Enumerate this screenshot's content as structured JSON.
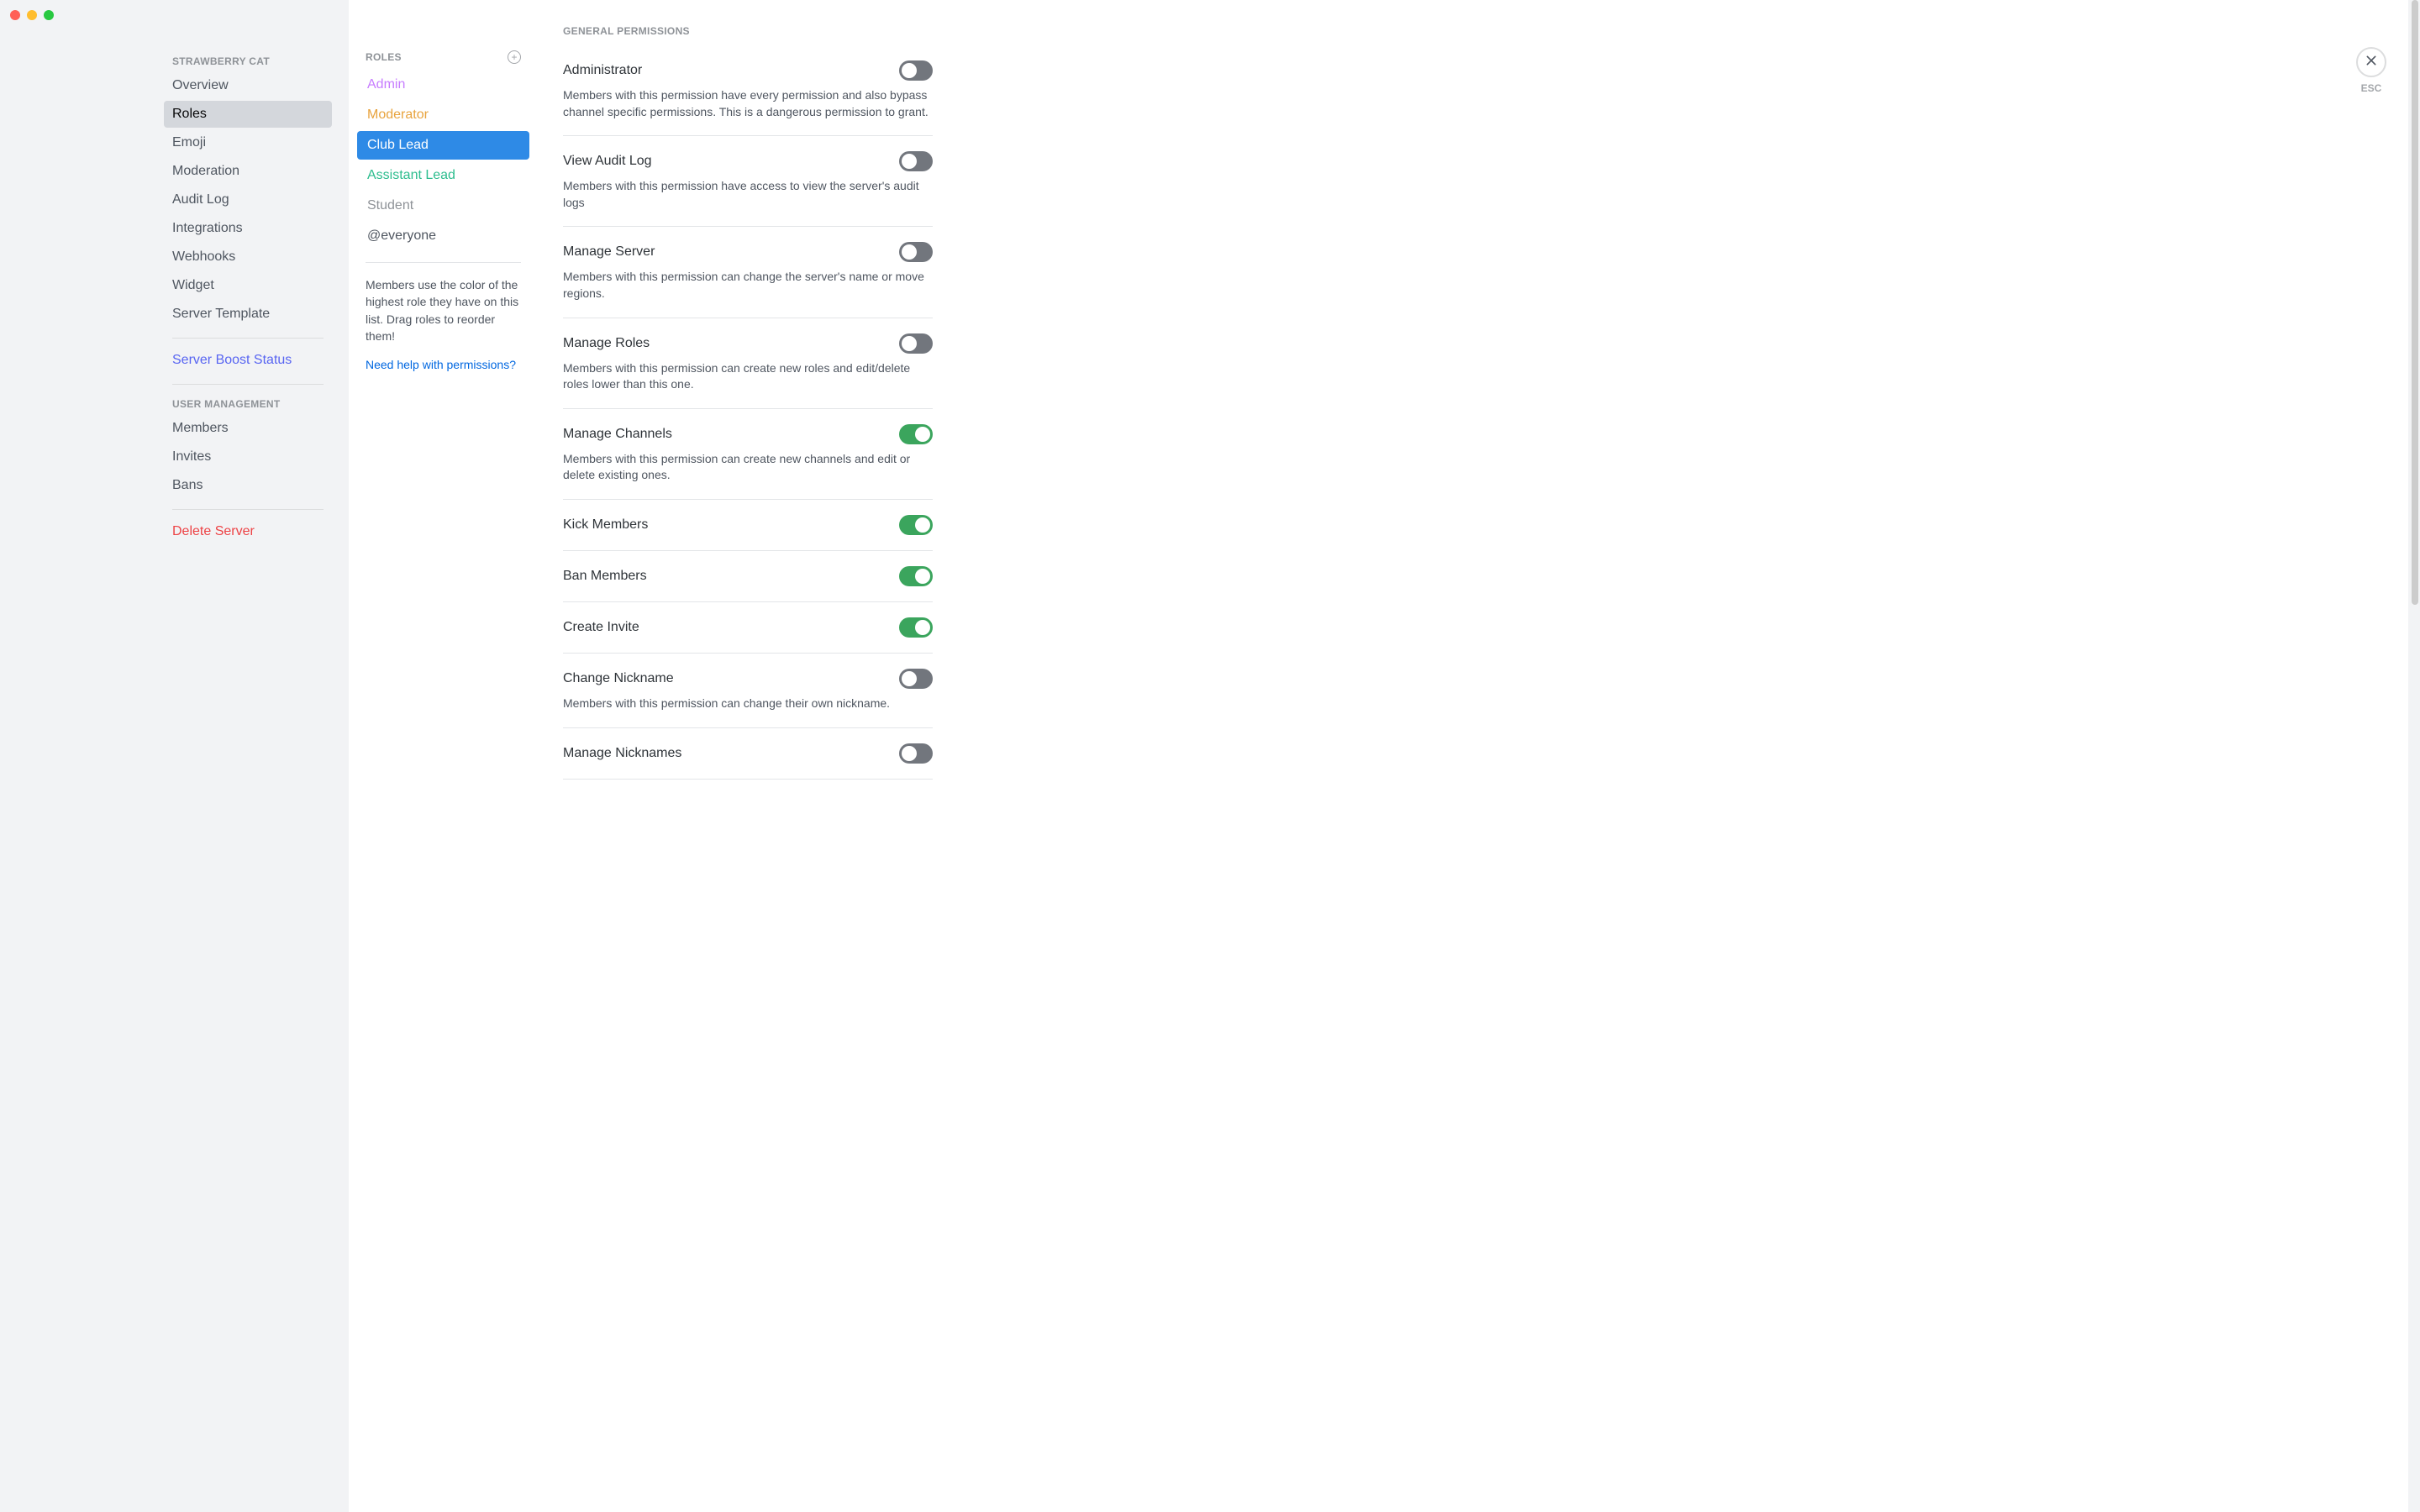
{
  "window": {
    "esc_label": "ESC"
  },
  "sidebar": {
    "server_name": "STRAWBERRY CAT",
    "items": [
      {
        "label": "Overview"
      },
      {
        "label": "Roles"
      },
      {
        "label": "Emoji"
      },
      {
        "label": "Moderation"
      },
      {
        "label": "Audit Log"
      },
      {
        "label": "Integrations"
      },
      {
        "label": "Webhooks"
      },
      {
        "label": "Widget"
      },
      {
        "label": "Server Template"
      }
    ],
    "boost_label": "Server Boost Status",
    "user_mgmt_header": "USER MANAGEMENT",
    "user_items": [
      {
        "label": "Members"
      },
      {
        "label": "Invites"
      },
      {
        "label": "Bans"
      }
    ],
    "delete_label": "Delete Server"
  },
  "roles": {
    "header": "ROLES",
    "list": [
      {
        "label": "Admin",
        "color": "#c77dff",
        "selected": false
      },
      {
        "label": "Moderator",
        "color": "#e8a33d",
        "selected": false
      },
      {
        "label": "Club Lead",
        "color": "#ffffff",
        "selected": true
      },
      {
        "label": "Assistant Lead",
        "color": "#2dbd8e",
        "selected": false
      },
      {
        "label": "Student",
        "color": "#8e9297",
        "selected": false
      },
      {
        "label": "@everyone",
        "color": "#4f5660",
        "selected": false
      }
    ],
    "hint": "Members use the color of the highest role they have on this list. Drag roles to reorder them!",
    "help_link": "Need help with permissions?"
  },
  "permissions": {
    "section_header": "GENERAL PERMISSIONS",
    "items": [
      {
        "title": "Administrator",
        "desc": "Members with this permission have every permission and also bypass channel specific permissions. This is a dangerous permission to grant.",
        "on": false
      },
      {
        "title": "View Audit Log",
        "desc": "Members with this permission have access to view the server's audit logs",
        "on": false
      },
      {
        "title": "Manage Server",
        "desc": "Members with this permission can change the server's name or move regions.",
        "on": false
      },
      {
        "title": "Manage Roles",
        "desc": "Members with this permission can create new roles and edit/delete roles lower than this one.",
        "on": false
      },
      {
        "title": "Manage Channels",
        "desc": "Members with this permission can create new channels and edit or delete existing ones.",
        "on": true
      },
      {
        "title": "Kick Members",
        "desc": "",
        "on": true
      },
      {
        "title": "Ban Members",
        "desc": "",
        "on": true
      },
      {
        "title": "Create Invite",
        "desc": "",
        "on": true
      },
      {
        "title": "Change Nickname",
        "desc": "Members with this permission can change their own nickname.",
        "on": false
      },
      {
        "title": "Manage Nicknames",
        "desc": "",
        "on": false
      }
    ]
  }
}
